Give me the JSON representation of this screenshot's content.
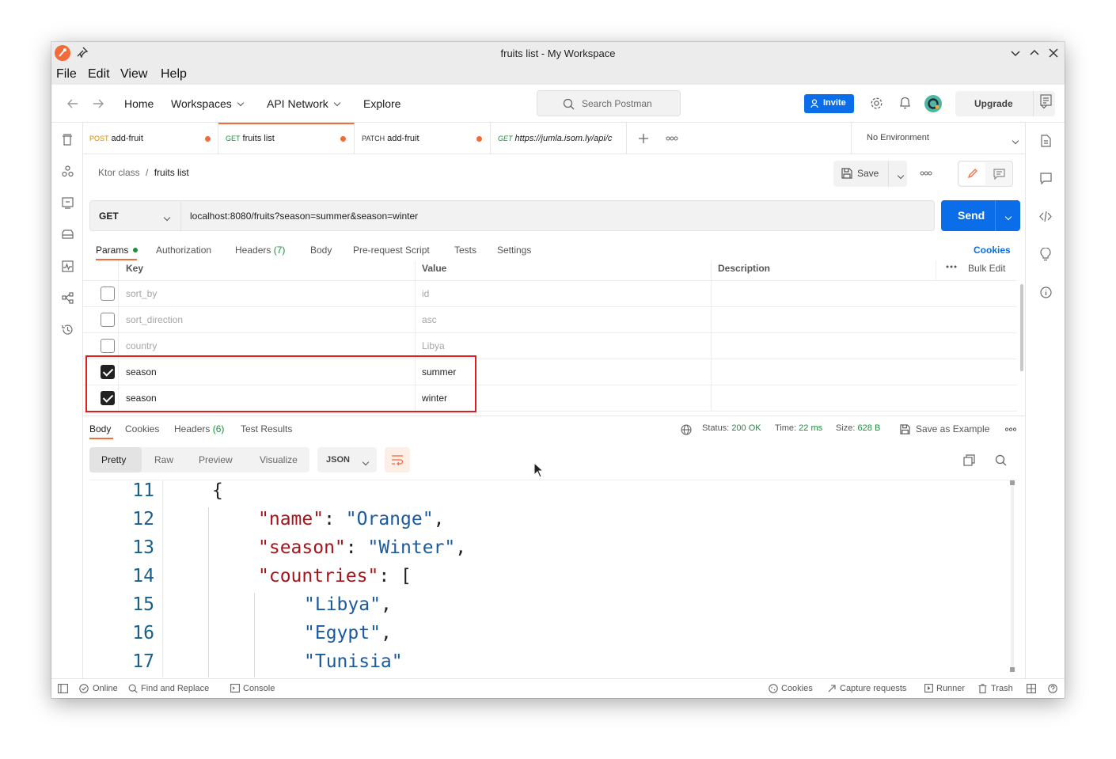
{
  "window": {
    "title": "fruits list - My Workspace"
  },
  "menu": [
    "File",
    "Edit",
    "View",
    "Help"
  ],
  "header": {
    "nav": [
      "Home",
      "Workspaces",
      "API Network",
      "Explore"
    ],
    "search_placeholder": "Search Postman",
    "invite": "Invite",
    "upgrade": "Upgrade"
  },
  "tabs": [
    {
      "method": "POST",
      "name": "add-fruit",
      "method_color": "#d38b00",
      "unsaved": true
    },
    {
      "method": "GET",
      "name": "fruits list",
      "method_color": "#1a8f3c",
      "unsaved": true,
      "active": true
    },
    {
      "method": "PATCH",
      "name": "add-fruit",
      "method_color": "#333333",
      "unsaved": true
    },
    {
      "method": "GET",
      "name": "https://jumla.isom.ly/api/c",
      "method_color": "#1a8f3c",
      "unsaved": false
    }
  ],
  "environment": "No Environment",
  "breadcrumb": {
    "collection": "Ktor class",
    "sep": "/",
    "request": "fruits list"
  },
  "toolbar": {
    "save": "Save"
  },
  "request": {
    "method": "GET",
    "url": "localhost:8080/fruits?season=summer&season=winter",
    "send": "Send"
  },
  "request_tabs": [
    {
      "label": "Params",
      "active": true
    },
    {
      "label": "Authorization"
    },
    {
      "label": "Headers",
      "count": "(7)"
    },
    {
      "label": "Body"
    },
    {
      "label": "Pre-request Script"
    },
    {
      "label": "Tests"
    },
    {
      "label": "Settings"
    }
  ],
  "cookies_link": "Cookies",
  "params": {
    "headers": {
      "key": "Key",
      "value": "Value",
      "description": "Description",
      "bulk": "Bulk Edit"
    },
    "rows": [
      {
        "key": "sort_by",
        "value": "id",
        "checked": false
      },
      {
        "key": "sort_direction",
        "value": "asc",
        "checked": false
      },
      {
        "key": "country",
        "value": "Libya",
        "checked": false
      },
      {
        "key": "season",
        "value": "summer",
        "checked": true
      },
      {
        "key": "season",
        "value": "winter",
        "checked": true
      }
    ]
  },
  "response": {
    "tabs": [
      {
        "label": "Body",
        "active": true
      },
      {
        "label": "Cookies"
      },
      {
        "label": "Headers",
        "count": "(6)"
      },
      {
        "label": "Test Results"
      }
    ],
    "status_label": "Status:",
    "status": "200 OK",
    "time_label": "Time:",
    "time": "22 ms",
    "size_label": "Size:",
    "size": "628 B",
    "save_example": "Save as Example",
    "views": [
      "Pretty",
      "Raw",
      "Preview",
      "Visualize"
    ],
    "format": "JSON"
  },
  "code_lines": [
    {
      "n": "11",
      "indent": 1,
      "parts": [
        {
          "t": "{",
          "c": "punc"
        }
      ]
    },
    {
      "n": "12",
      "indent": 2,
      "parts": [
        {
          "t": "\"name\"",
          "c": "key"
        },
        {
          "t": ": ",
          "c": "punc"
        },
        {
          "t": "\"Orange\"",
          "c": "str"
        },
        {
          "t": ",",
          "c": "punc"
        }
      ]
    },
    {
      "n": "13",
      "indent": 2,
      "parts": [
        {
          "t": "\"season\"",
          "c": "key"
        },
        {
          "t": ": ",
          "c": "punc"
        },
        {
          "t": "\"Winter\"",
          "c": "str"
        },
        {
          "t": ",",
          "c": "punc"
        }
      ]
    },
    {
      "n": "14",
      "indent": 2,
      "parts": [
        {
          "t": "\"countries\"",
          "c": "key"
        },
        {
          "t": ": [",
          "c": "punc"
        }
      ]
    },
    {
      "n": "15",
      "indent": 3,
      "parts": [
        {
          "t": "\"Libya\"",
          "c": "str"
        },
        {
          "t": ",",
          "c": "punc"
        }
      ]
    },
    {
      "n": "16",
      "indent": 3,
      "parts": [
        {
          "t": "\"Egypt\"",
          "c": "str"
        },
        {
          "t": ",",
          "c": "punc"
        }
      ]
    },
    {
      "n": "17",
      "indent": 3,
      "parts": [
        {
          "t": "\"Tunisia\"",
          "c": "str"
        }
      ]
    }
  ],
  "statusbar": {
    "online": "Online",
    "find": "Find and Replace",
    "console": "Console",
    "cookies": "Cookies",
    "capture": "Capture requests",
    "runner": "Runner",
    "trash": "Trash"
  }
}
